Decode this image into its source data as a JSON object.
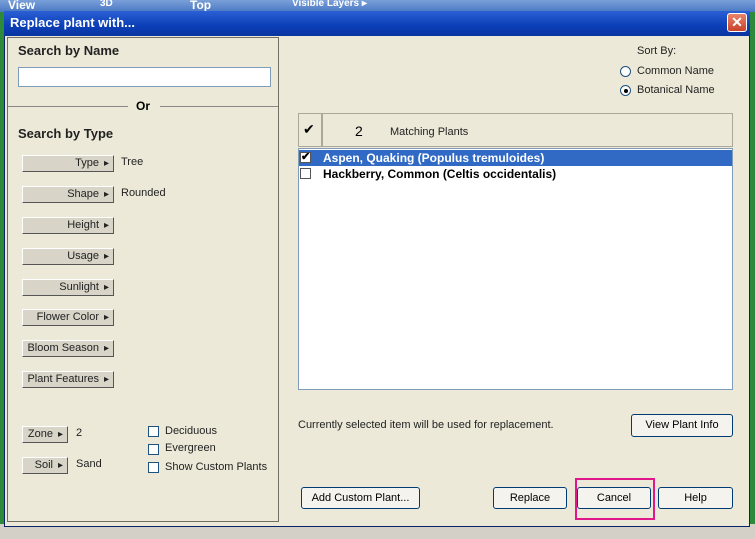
{
  "background_app": {
    "menu_view": "View",
    "menu_3d": "3D",
    "menu_top": "Top",
    "layers_label": "Visible Layers ▸"
  },
  "dialog": {
    "title": "Replace plant with...",
    "close_glyph": "✕"
  },
  "left": {
    "search_by_name": "Search by Name",
    "search_value": "",
    "or": "Or",
    "search_by_type": "Search by Type",
    "filters": [
      {
        "label": "Type",
        "value": "Tree"
      },
      {
        "label": "Shape",
        "value": "Rounded"
      },
      {
        "label": "Height",
        "value": ""
      },
      {
        "label": "Usage",
        "value": ""
      },
      {
        "label": "Sunlight",
        "value": ""
      },
      {
        "label": "Flower Color",
        "value": ""
      },
      {
        "label": "Bloom Season",
        "value": ""
      },
      {
        "label": "Plant Features",
        "value": ""
      }
    ],
    "zone": {
      "label": "Zone",
      "value": "2"
    },
    "soil": {
      "label": "Soil",
      "value": "Sand"
    },
    "checkboxes": [
      {
        "label": "Deciduous",
        "checked": false
      },
      {
        "label": "Evergreen",
        "checked": false
      },
      {
        "label": "Show Custom Plants",
        "checked": false
      }
    ]
  },
  "right": {
    "sort_by": "Sort By:",
    "sort_options": [
      {
        "label": "Common Name",
        "selected": false
      },
      {
        "label": "Botanical Name",
        "selected": true
      }
    ],
    "count": "2",
    "matching_label": "Matching Plants",
    "header_check": "✔",
    "plants": [
      {
        "name": "Aspen, Quaking (Populus tremuloides)",
        "checked": true,
        "selected": true
      },
      {
        "name": "Hackberry, Common (Celtis occidentalis)",
        "checked": false,
        "selected": false
      }
    ],
    "info_text": "Currently selected item will be used for replacement.",
    "view_info_label": "View Plant Info"
  },
  "buttons": {
    "add_custom": "Add Custom Plant...",
    "replace": "Replace",
    "cancel": "Cancel",
    "help": "Help"
  }
}
